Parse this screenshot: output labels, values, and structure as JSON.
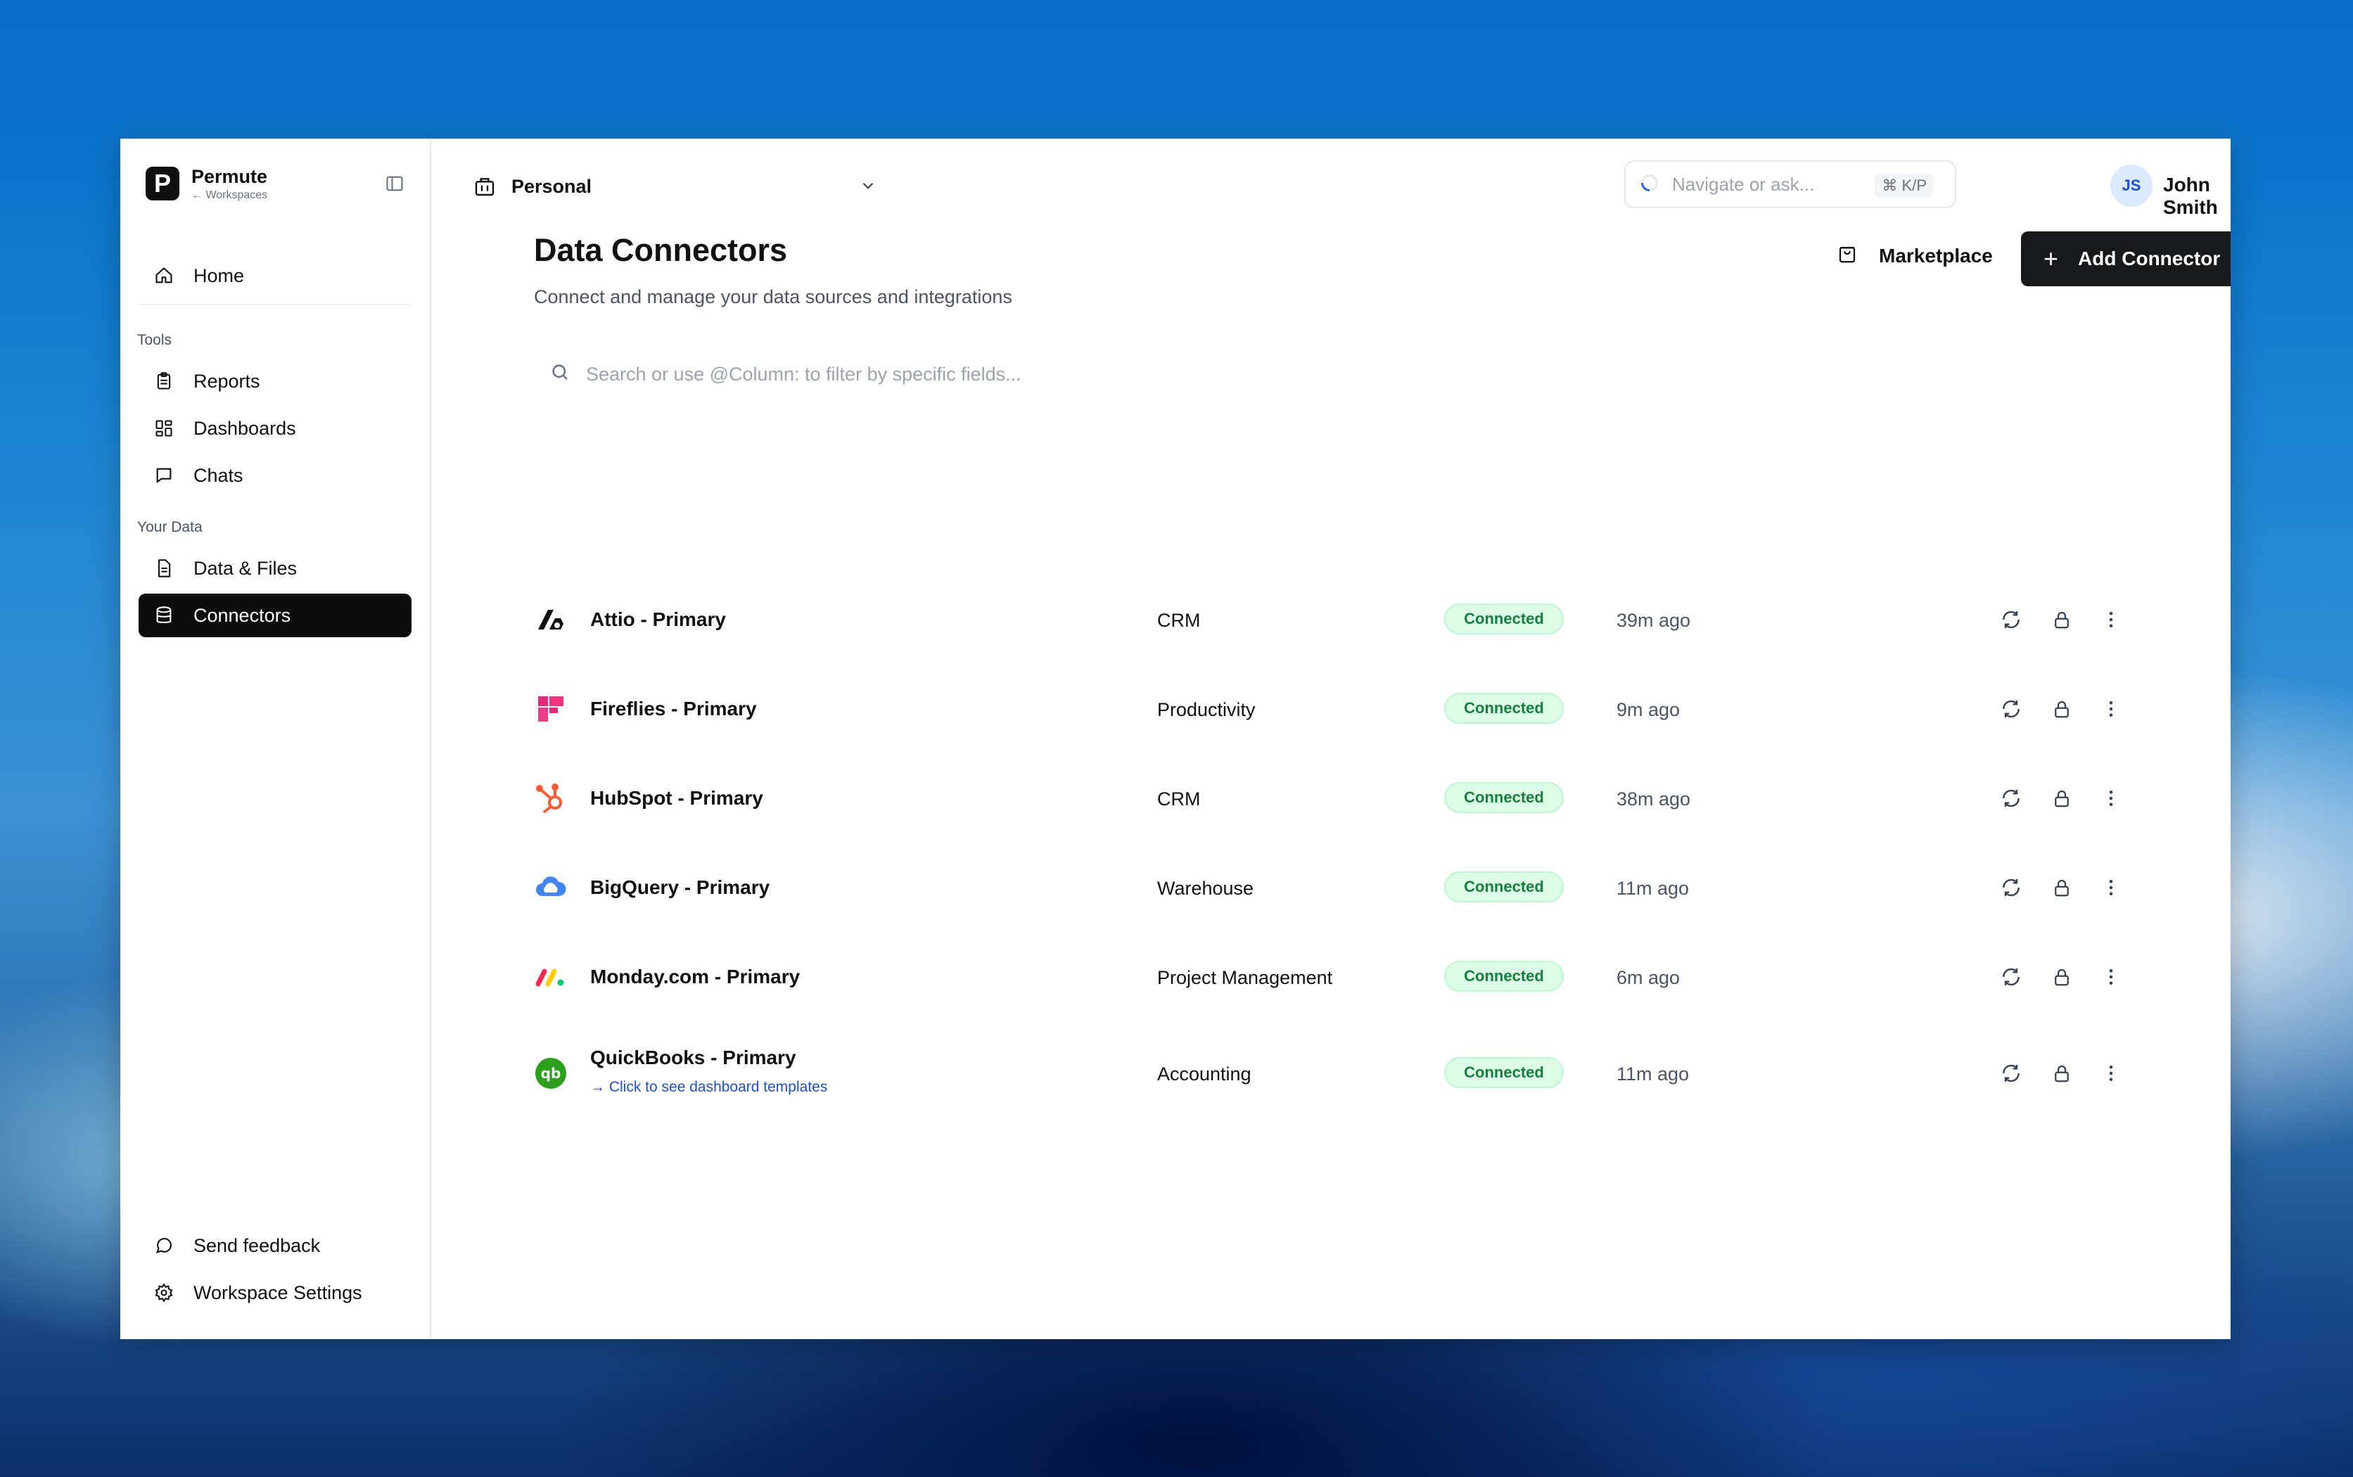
{
  "sidebar": {
    "brand": {
      "name": "Permute",
      "sub": "← Workspaces",
      "logo_letter": "P"
    },
    "home": "Home",
    "tools_label": "Tools",
    "tools": [
      "Reports",
      "Dashboards",
      "Chats"
    ],
    "data_label": "Your Data",
    "data_items": [
      "Data & Files",
      "Connectors"
    ],
    "footer": [
      "Send feedback",
      "Workspace Settings"
    ]
  },
  "header": {
    "workspace": "Personal",
    "search_placeholder": "Navigate or ask...",
    "search_shortcut": "⌘ K/P",
    "user_initials": "JS",
    "user_name": "John Smith"
  },
  "page": {
    "title": "Data Connectors",
    "subtitle": "Connect and manage your data sources and integrations",
    "marketplace": "Marketplace",
    "add_connector": "Add Connector",
    "filter_placeholder": "Search or use @Column: to filter by specific fields..."
  },
  "connectors": [
    {
      "name": "Attio - Primary",
      "category": "CRM",
      "status": "Connected",
      "synced": "39m ago",
      "icon": "attio-logo"
    },
    {
      "name": "Fireflies - Primary",
      "category": "Productivity",
      "status": "Connected",
      "synced": "9m ago",
      "icon": "fireflies-logo"
    },
    {
      "name": "HubSpot - Primary",
      "category": "CRM",
      "status": "Connected",
      "synced": "38m ago",
      "icon": "hubspot-logo"
    },
    {
      "name": "BigQuery - Primary",
      "category": "Warehouse",
      "status": "Connected",
      "synced": "11m ago",
      "icon": "bigquery-logo"
    },
    {
      "name": "Monday.com - Primary",
      "category": "Project Management",
      "status": "Connected",
      "synced": "6m ago",
      "icon": "monday-logo"
    },
    {
      "name": "QuickBooks - Primary",
      "link": "→ Click to see dashboard templates",
      "category": "Accounting",
      "status": "Connected",
      "synced": "11m ago",
      "icon": "quickbooks-logo"
    }
  ],
  "colors": {
    "accent": "#18191b",
    "status_bg": "#dcfce7",
    "status_text": "#15803d",
    "link": "#1d4ed8"
  }
}
